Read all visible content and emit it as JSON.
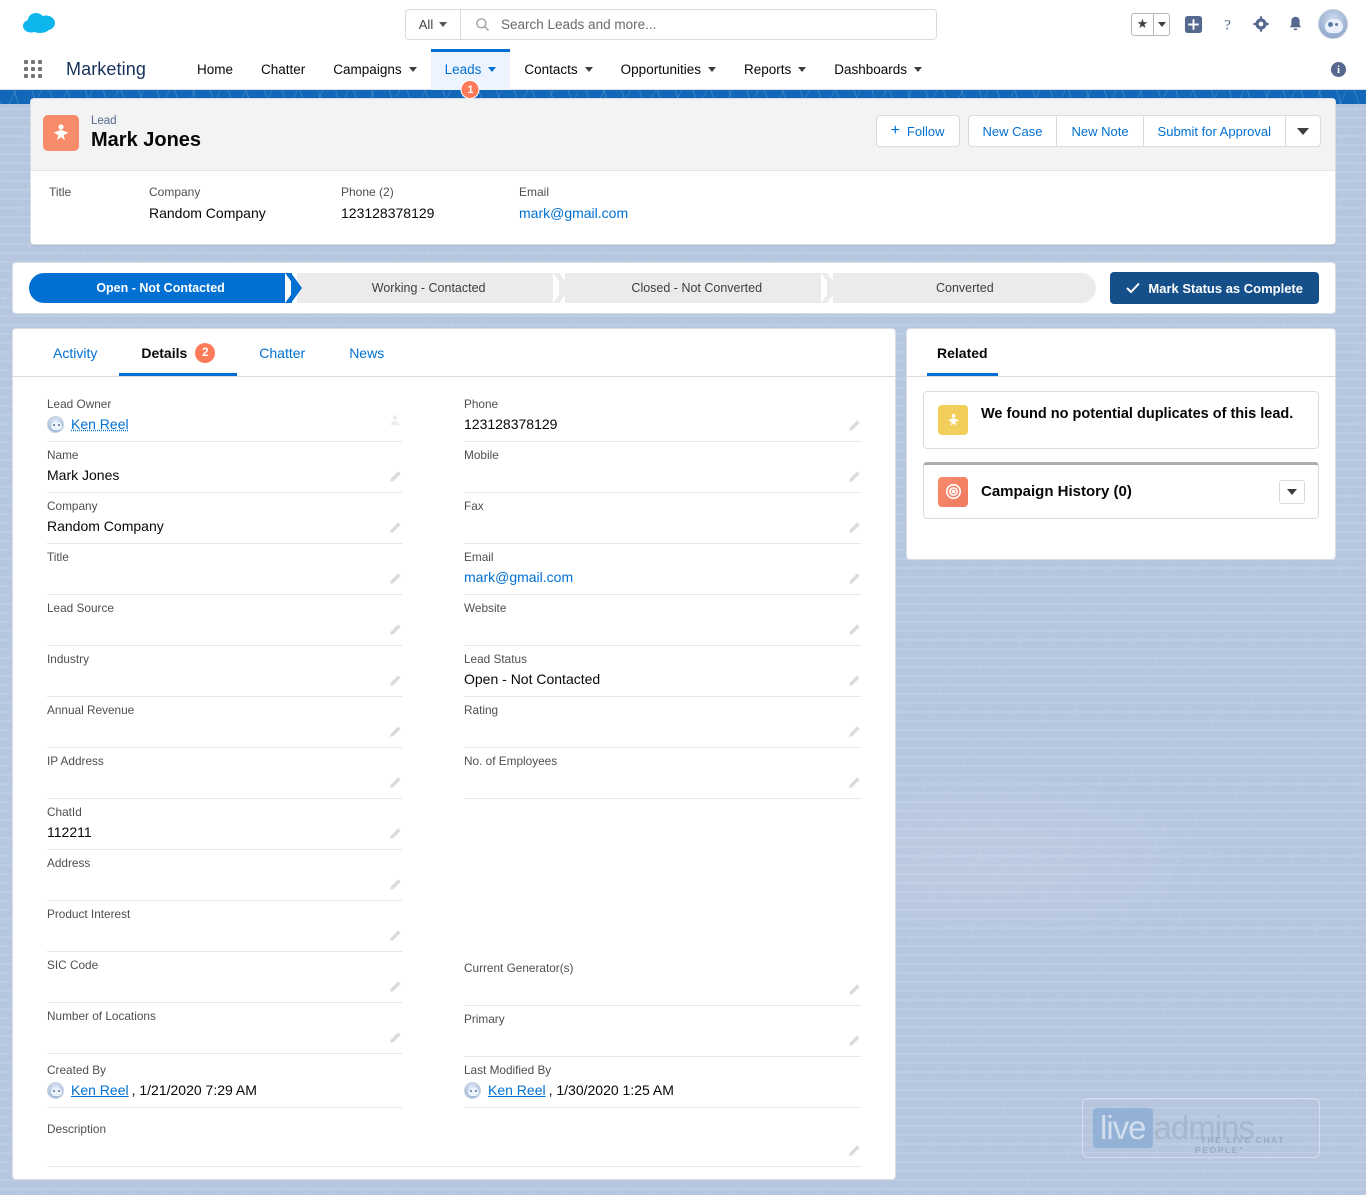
{
  "header": {
    "logo": "salesforce-cloud-logo",
    "search": {
      "scope": "All",
      "placeholder": "Search Leads and more...",
      "value": ""
    },
    "icons": [
      "favorites-star-icon",
      "favorites-caret-icon",
      "add-icon",
      "help-icon",
      "setup-gear-icon",
      "notifications-bell-icon",
      "user-avatar"
    ]
  },
  "nav": {
    "app_name": "Marketing",
    "items": [
      {
        "label": "Home",
        "has_caret": false,
        "active": false,
        "badge": ""
      },
      {
        "label": "Chatter",
        "has_caret": false,
        "active": false,
        "badge": ""
      },
      {
        "label": "Campaigns",
        "has_caret": true,
        "active": false,
        "badge": ""
      },
      {
        "label": "Leads",
        "has_caret": true,
        "active": true,
        "badge": "1"
      },
      {
        "label": "Contacts",
        "has_caret": true,
        "active": false,
        "badge": ""
      },
      {
        "label": "Opportunities",
        "has_caret": true,
        "active": false,
        "badge": ""
      },
      {
        "label": "Reports",
        "has_caret": true,
        "active": false,
        "badge": ""
      },
      {
        "label": "Dashboards",
        "has_caret": true,
        "active": false,
        "badge": ""
      }
    ],
    "info_icon": "i"
  },
  "record": {
    "type_label": "Lead",
    "name": "Mark Jones",
    "icon": "lead-icon",
    "actions": {
      "follow": "Follow",
      "new_case": "New Case",
      "new_note": "New Note",
      "submit_for_approval": "Submit for Approval",
      "more": "more-actions-caret"
    },
    "summary_fields": [
      {
        "label": "Title",
        "value": ""
      },
      {
        "label": "Company",
        "value": "Random Company"
      },
      {
        "label": "Phone (2)",
        "value": "123128378129"
      },
      {
        "label": "Email",
        "value": "mark@gmail.com"
      }
    ]
  },
  "path": {
    "steps": [
      {
        "label": "Open - Not Contacted",
        "state": "current"
      },
      {
        "label": "Working - Contacted",
        "state": "incomplete"
      },
      {
        "label": "Closed - Not Converted",
        "state": "incomplete"
      },
      {
        "label": "Converted",
        "state": "incomplete"
      }
    ],
    "mark_complete_label": "Mark Status as Complete"
  },
  "detail": {
    "tabs": [
      {
        "label": "Activity",
        "active": false,
        "badge": ""
      },
      {
        "label": "Details",
        "active": true,
        "badge": "2"
      },
      {
        "label": "Chatter",
        "active": false,
        "badge": ""
      },
      {
        "label": "News",
        "active": false,
        "badge": ""
      }
    ],
    "left_fields": [
      {
        "label": "Lead Owner",
        "value": "Ken Reel",
        "kind": "owner"
      },
      {
        "label": "Name",
        "value": "Mark Jones",
        "kind": "text"
      },
      {
        "label": "Company",
        "value": "Random Company",
        "kind": "text"
      },
      {
        "label": "Title",
        "value": "",
        "kind": "text"
      },
      {
        "label": "Lead Source",
        "value": "",
        "kind": "text"
      },
      {
        "label": "Industry",
        "value": "",
        "kind": "text"
      },
      {
        "label": "Annual Revenue",
        "value": "",
        "kind": "text"
      },
      {
        "label": "IP Address",
        "value": "",
        "kind": "text"
      },
      {
        "label": "ChatId",
        "value": "112211",
        "kind": "text"
      },
      {
        "label": "Address",
        "value": "",
        "kind": "text"
      },
      {
        "label": "Product Interest",
        "value": "",
        "kind": "text"
      },
      {
        "label": "SIC Code",
        "value": "",
        "kind": "text"
      },
      {
        "label": "Number of Locations",
        "value": "",
        "kind": "text"
      }
    ],
    "right_fields": [
      {
        "label": "Phone",
        "value": "123128378129",
        "kind": "text"
      },
      {
        "label": "Mobile",
        "value": "",
        "kind": "text"
      },
      {
        "label": "Fax",
        "value": "",
        "kind": "text"
      },
      {
        "label": "Email",
        "value": "mark@gmail.com",
        "kind": "link"
      },
      {
        "label": "Website",
        "value": "",
        "kind": "text"
      },
      {
        "label": "Lead Status",
        "value": "Open - Not Contacted",
        "kind": "text"
      },
      {
        "label": "Rating",
        "value": "",
        "kind": "text"
      },
      {
        "label": "No. of Employees",
        "value": "",
        "kind": "text"
      },
      {
        "label": "Current Generator(s)",
        "value": "",
        "kind": "text"
      },
      {
        "label": "Primary",
        "value": "",
        "kind": "text"
      }
    ],
    "created_by": {
      "label": "Created By",
      "user": "Ken Reel",
      "timestamp": ", 1/21/2020 7:29 AM"
    },
    "last_modified_by": {
      "label": "Last Modified By",
      "user": "Ken Reel",
      "timestamp": ", 1/30/2020 1:25 AM"
    },
    "description": {
      "label": "Description",
      "value": ""
    }
  },
  "related": {
    "tab_label": "Related",
    "duplicates_message": "We found no potential duplicates of this lead.",
    "campaign_history": {
      "title": "Campaign History (0)",
      "toggle": "campaign-history-caret"
    }
  },
  "watermark": {
    "live": "live",
    "admins": "admins",
    "tagline": "\"THE LIVE CHAT PEOPLE\""
  },
  "colors": {
    "brand_blue": "#0070d2",
    "path_complete_blue": "#16508b",
    "badge_orange": "#ff7a59",
    "lead_icon": "#f88b69",
    "duplicate_icon": "#f2cf5b",
    "page_bg": "#b6c6df",
    "strip_blue": "#1267b8"
  }
}
